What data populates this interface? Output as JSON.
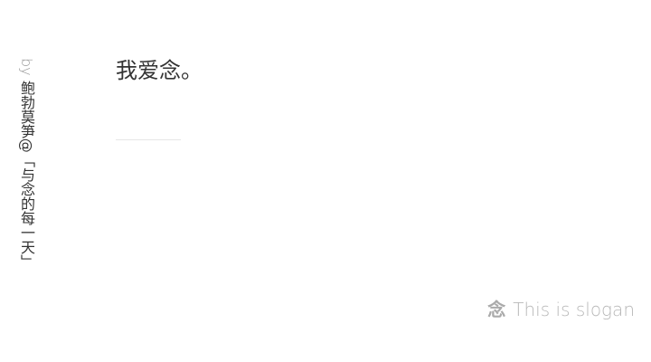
{
  "byline": {
    "prefix": "by",
    "author": "鲍勃莫笋@「与念的每一天」"
  },
  "post": {
    "title": "我爱念。"
  },
  "slogan": {
    "icon_glyph": "念",
    "icon": "nian-logo-icon",
    "text": "This is slogan"
  },
  "colors": {
    "text": "#333333",
    "muted": "#999999",
    "divider": "#e6e6e6",
    "slogan": "#b8b8b8"
  }
}
